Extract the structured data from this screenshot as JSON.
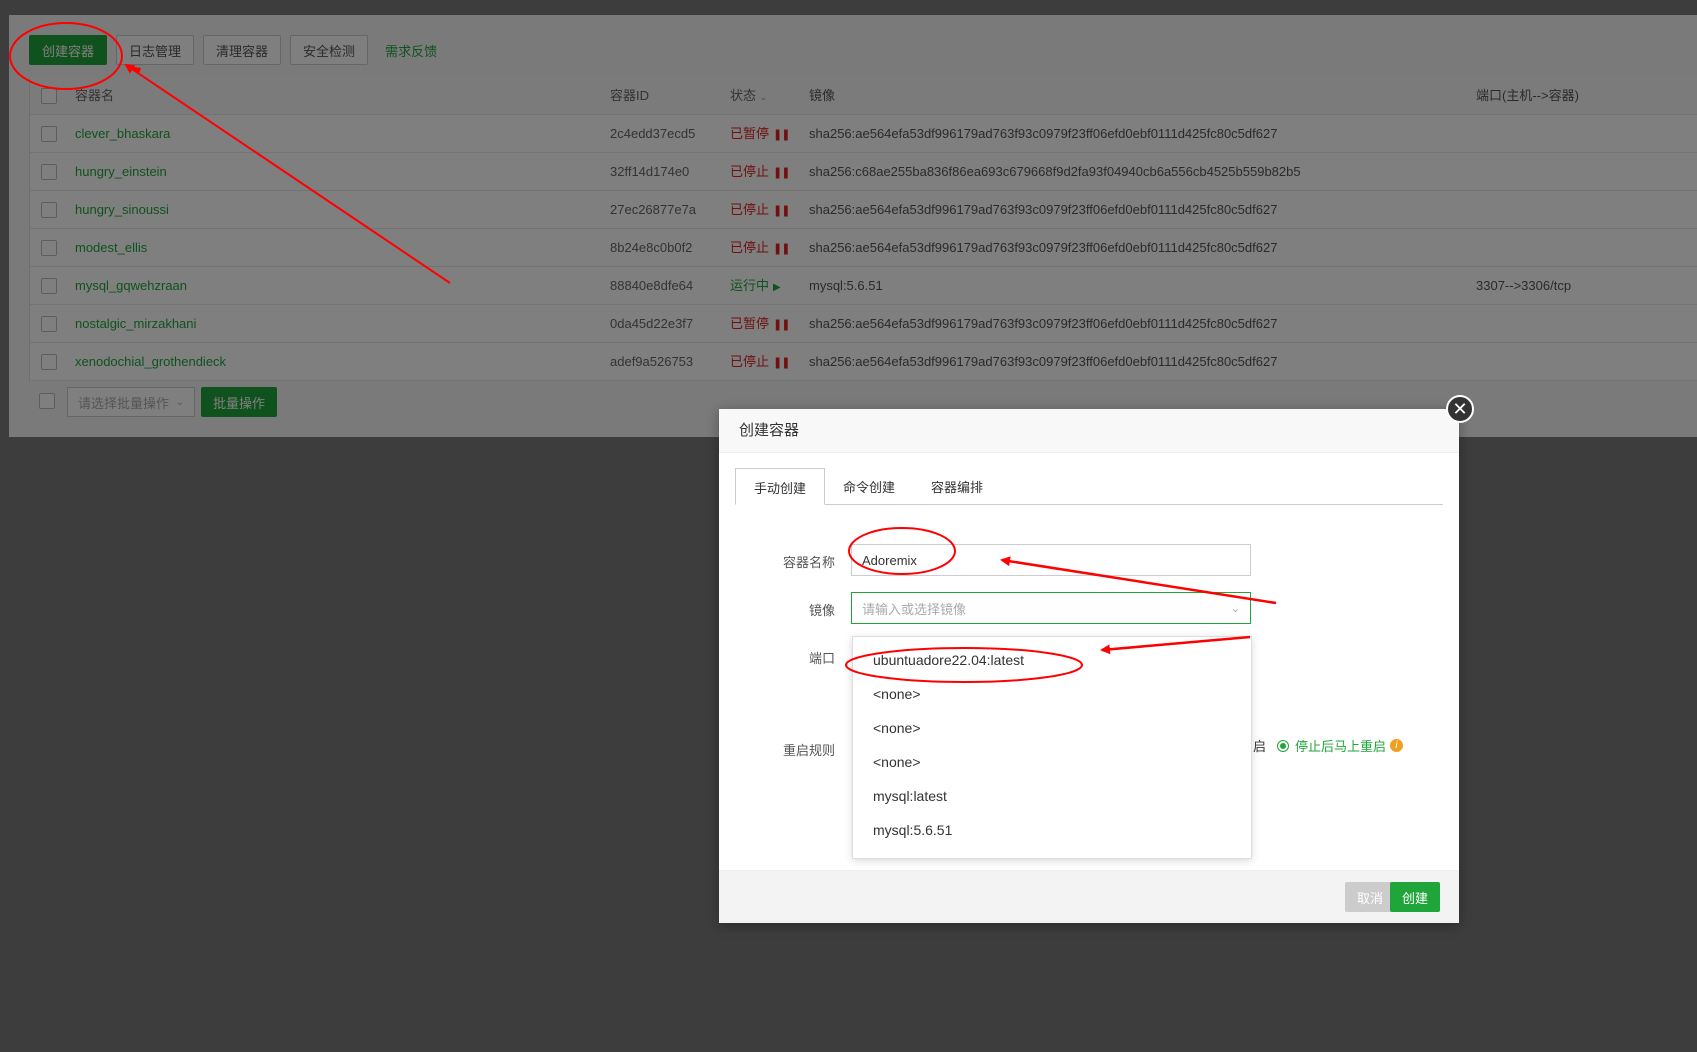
{
  "toolbar": {
    "create_container": "创建容器",
    "log_manage": "日志管理",
    "clean_container": "清理容器",
    "security_check": "安全检测",
    "feedback": "需求反馈"
  },
  "table": {
    "headers": {
      "name": "容器名",
      "id": "容器ID",
      "status": "状态",
      "status_sort_icon": "chevron-down-icon",
      "image": "镜像",
      "port": "端口(主机-->容器)"
    },
    "rows": [
      {
        "name": "clever_bhaskara",
        "id": "2c4edd37ecd5",
        "status": "已暂停",
        "status_type": "stop",
        "image": "sha256:ae564efa53df996179ad763f93c0979f23ff06efd0ebf0111d425fc80c5df627",
        "port": ""
      },
      {
        "name": "hungry_einstein",
        "id": "32ff14d174e0",
        "status": "已停止",
        "status_type": "stop",
        "image": "sha256:c68ae255ba836f86ea693c679668f9d2fa93f04940cb6a556cb4525b559b82b5",
        "port": ""
      },
      {
        "name": "hungry_sinoussi",
        "id": "27ec26877e7a",
        "status": "已停止",
        "status_type": "stop",
        "image": "sha256:ae564efa53df996179ad763f93c0979f23ff06efd0ebf0111d425fc80c5df627",
        "port": ""
      },
      {
        "name": "modest_ellis",
        "id": "8b24e8c0b0f2",
        "status": "已停止",
        "status_type": "stop",
        "image": "sha256:ae564efa53df996179ad763f93c0979f23ff06efd0ebf0111d425fc80c5df627",
        "port": ""
      },
      {
        "name": "mysql_gqwehzraan",
        "id": "88840e8dfe64",
        "status": "运行中",
        "status_type": "run",
        "image": "mysql:5.6.51",
        "port": "3307-->3306/tcp"
      },
      {
        "name": "nostalgic_mirzakhani",
        "id": "0da45d22e3f7",
        "status": "已暂停",
        "status_type": "stop",
        "image": "sha256:ae564efa53df996179ad763f93c0979f23ff06efd0ebf0111d425fc80c5df627",
        "port": ""
      },
      {
        "name": "xenodochial_grothendieck",
        "id": "adef9a526753",
        "status": "已停止",
        "status_type": "stop",
        "image": "sha256:ae564efa53df996179ad763f93c0979f23ff06efd0ebf0111d425fc80c5df627",
        "port": ""
      }
    ]
  },
  "batch": {
    "select_placeholder": "请选择批量操作",
    "button": "批量操作"
  },
  "dialog": {
    "title": "创建容器",
    "tabs": [
      "手动创建",
      "命令创建",
      "容器编排"
    ],
    "active_tab": "手动创建",
    "fields": {
      "name_label": "容器名称",
      "name_value": "Adoremix",
      "image_label": "镜像",
      "image_placeholder": "请输入或选择镜像",
      "port_label": "端口",
      "restart_label": "重启规则",
      "restart_partial": "启",
      "restart_option": "停止后马上重启"
    },
    "dropdown_options": [
      "ubuntuadore22.04:latest",
      "<none>",
      "<none>",
      "<none>",
      "mysql:latest",
      "mysql:5.6.51"
    ],
    "cancel": "取消",
    "create": "创建"
  },
  "colors": {
    "accent": "#20a53a",
    "danger": "#e02020",
    "annotation": "#ff0000"
  }
}
